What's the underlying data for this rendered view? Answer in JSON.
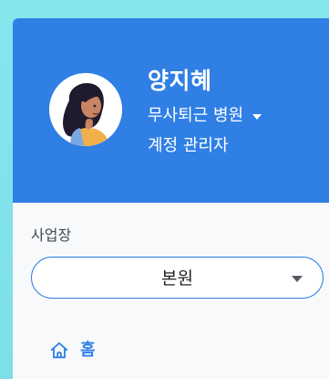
{
  "user": {
    "name": "양지혜",
    "organization": "무사퇴근 병원",
    "role": "계정 관리자"
  },
  "site": {
    "label": "사업장",
    "selected": "본원"
  },
  "nav": {
    "items": [
      {
        "label": "홈",
        "icon": "home-icon"
      }
    ]
  },
  "colors": {
    "header": "#2f7fe5",
    "accent": "#2f7fe5",
    "background": "#7fe0ea"
  }
}
